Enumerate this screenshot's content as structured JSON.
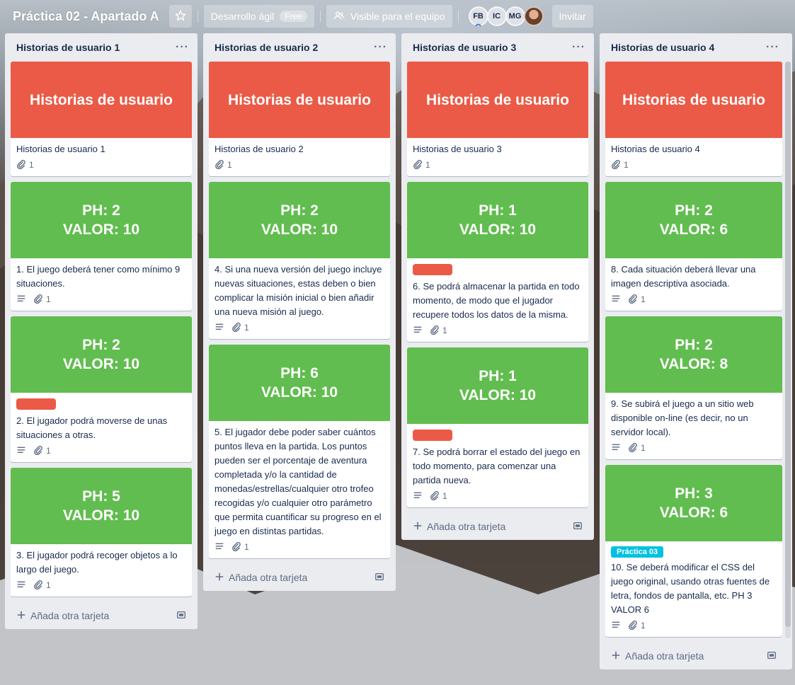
{
  "header": {
    "board_title": "Práctica 02 - Apartado A",
    "star_icon": "star-icon",
    "workspace_label": "Desarrollo ágil",
    "workspace_badge": "Free",
    "visibility_label": "Visible para el equipo",
    "members": [
      {
        "initials": "FB"
      },
      {
        "initials": "IC"
      },
      {
        "initials": "MG"
      },
      {
        "initials": ""
      }
    ],
    "invite_label": "Invitar"
  },
  "colors": {
    "cover_red": "#eb5a46",
    "cover_green": "#61bd4f",
    "label_red": "#eb5a46",
    "label_teal": "#00c2e0"
  },
  "lists": [
    {
      "title": "Historias de usuario 1",
      "add_card_label": "Añada otra tarjeta",
      "cards": [
        {
          "cover_color": "red",
          "cover_lines": [
            "Historias de usuario"
          ],
          "labels": [],
          "text": "Historias de usuario 1",
          "description": false,
          "attachments": "1"
        },
        {
          "cover_color": "green",
          "cover_lines": [
            "PH: 2",
            "VALOR: 10"
          ],
          "labels": [],
          "text": "1. El juego deberá tener como mínimo 9 situaciones.",
          "description": true,
          "attachments": "1"
        },
        {
          "cover_color": "green",
          "cover_lines": [
            "PH: 2",
            "VALOR: 10"
          ],
          "labels": [
            "red"
          ],
          "text": "2. El jugador podrá moverse de unas situaciones a otras.",
          "description": true,
          "attachments": "1"
        },
        {
          "cover_color": "green",
          "cover_lines": [
            "PH: 5",
            "VALOR: 10"
          ],
          "labels": [],
          "text": "3. El jugador podrá recoger objetos a lo largo del juego.",
          "description": true,
          "attachments": "1"
        }
      ]
    },
    {
      "title": "Historias de usuario 2",
      "add_card_label": "Añada otra tarjeta",
      "cards": [
        {
          "cover_color": "red",
          "cover_lines": [
            "Historias de usuario"
          ],
          "labels": [],
          "text": "Historias de usuario 2",
          "description": false,
          "attachments": "1"
        },
        {
          "cover_color": "green",
          "cover_lines": [
            "PH: 2",
            "VALOR: 10"
          ],
          "labels": [],
          "text": "4. Si una nueva versión del juego incluye nuevas situaciones, estas deben o bien complicar la misión inicial o bien añadir una nueva misión al juego.",
          "description": true,
          "attachments": "1"
        },
        {
          "cover_color": "green",
          "cover_lines": [
            "PH: 6",
            "VALOR: 10"
          ],
          "labels": [],
          "text": "5. El jugador debe poder saber cuántos puntos lleva en la partida. Los puntos pueden ser el porcentaje de aventura completada y/o la cantidad de monedas/estrellas/cualquier otro trofeo recogidas y/o cualquier otro parámetro que permita cuantificar su progreso en el juego en distintas partidas.",
          "description": true,
          "attachments": "1"
        }
      ]
    },
    {
      "title": "Historias de usuario 3",
      "add_card_label": "Añada otra tarjeta",
      "cards": [
        {
          "cover_color": "red",
          "cover_lines": [
            "Historias de usuario"
          ],
          "labels": [],
          "text": "Historias de usuario 3",
          "description": false,
          "attachments": "1"
        },
        {
          "cover_color": "green",
          "cover_lines": [
            "PH: 1",
            "VALOR: 10"
          ],
          "labels": [
            "red"
          ],
          "text": "6. Se podrá almacenar la partida en todo momento, de modo que el jugador recupere todos los datos de la misma.",
          "description": true,
          "attachments": "1"
        },
        {
          "cover_color": "green",
          "cover_lines": [
            "PH: 1",
            "VALOR: 10"
          ],
          "labels": [
            "red"
          ],
          "text": "7. Se podrá borrar el estado del juego en todo momento, para comenzar una partida nueva.",
          "description": true,
          "attachments": "1"
        }
      ]
    },
    {
      "title": "Historias de usuario 4",
      "add_card_label": "Añada otra tarjeta",
      "cards": [
        {
          "cover_color": "red",
          "cover_lines": [
            "Historias de usuario"
          ],
          "labels": [],
          "text": "Historias de usuario 4",
          "description": false,
          "attachments": "1"
        },
        {
          "cover_color": "green",
          "cover_lines": [
            "PH: 2",
            "VALOR: 6"
          ],
          "labels": [],
          "text": "8. Cada situación deberá llevar una imagen descriptiva asociada.",
          "description": true,
          "attachments": "1"
        },
        {
          "cover_color": "green",
          "cover_lines": [
            "PH: 2",
            "VALOR: 8"
          ],
          "labels": [],
          "text": "9. Se subirá el juego a un sitio web disponible on-line (es decir, no un servidor local).",
          "description": true,
          "attachments": "1"
        },
        {
          "cover_color": "green",
          "cover_lines": [
            "PH: 3",
            "VALOR: 6"
          ],
          "labels": [
            "Práctica 03"
          ],
          "text": "10. Se deberá modificar el CSS del juego original, usando otras fuentes de letra, fondos de pantalla, etc. PH 3 VALOR 6",
          "description": true,
          "attachments": "1"
        }
      ]
    }
  ]
}
